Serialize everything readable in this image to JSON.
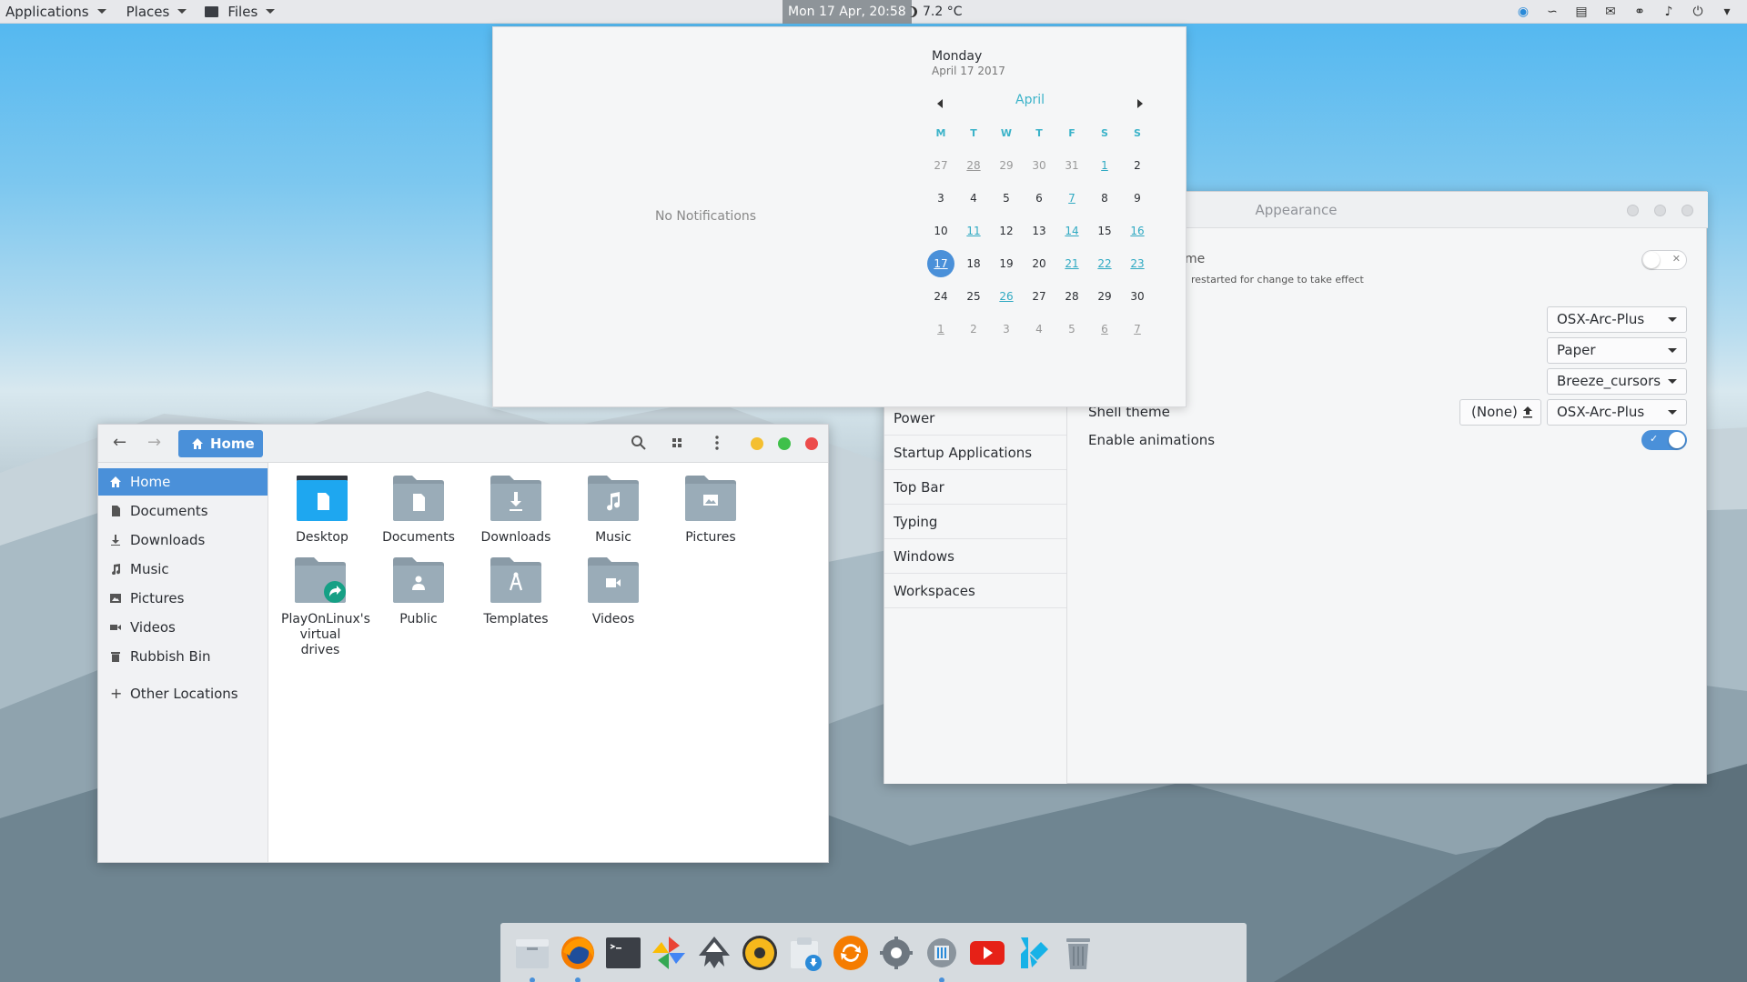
{
  "topbar": {
    "applications": "Applications",
    "places": "Places",
    "files": "Files",
    "clock": "Mon 17 Apr, 20:58",
    "weather": "7.2 °C"
  },
  "notifications": {
    "empty": "No Notifications"
  },
  "calendar": {
    "weekday": "Monday",
    "date": "April 17 2017",
    "month": "April",
    "weekdays": [
      "M",
      "T",
      "W",
      "T",
      "F",
      "S",
      "S"
    ],
    "days": [
      [
        "27",
        "28",
        "29",
        "30",
        "31",
        "1",
        "2"
      ],
      [
        "3",
        "4",
        "5",
        "6",
        "7",
        "8",
        "9"
      ],
      [
        "10",
        "11",
        "12",
        "13",
        "14",
        "15",
        "16"
      ],
      [
        "17",
        "18",
        "19",
        "20",
        "21",
        "22",
        "23"
      ],
      [
        "24",
        "25",
        "26",
        "27",
        "28",
        "29",
        "30"
      ],
      [
        "1",
        "2",
        "3",
        "4",
        "5",
        "6",
        "7"
      ]
    ]
  },
  "appearance": {
    "title": "Appearance",
    "hint_title": "me",
    "hint": "restarted for change to take effect",
    "sidebar": [
      "Power",
      "Startup Applications",
      "Top Bar",
      "Typing",
      "Windows",
      "Workspaces"
    ],
    "gtk_theme": "OSX-Arc-Plus",
    "icon_theme": "Paper",
    "cursor_theme": "Breeze_cursors",
    "shell_theme_label": "Shell theme",
    "shell_none": "(None)",
    "shell_theme": "OSX-Arc-Plus",
    "animations_label": "Enable animations",
    "animations_on": true
  },
  "files": {
    "path": "Home",
    "places": [
      "Home",
      "Documents",
      "Downloads",
      "Music",
      "Pictures",
      "Videos",
      "Rubbish Bin"
    ],
    "other": "Other Locations",
    "items": [
      {
        "name": "Desktop",
        "icon": "desktop-folder-icon"
      },
      {
        "name": "Documents",
        "icon": "documents-folder-icon"
      },
      {
        "name": "Downloads",
        "icon": "downloads-folder-icon"
      },
      {
        "name": "Music",
        "icon": "music-folder-icon"
      },
      {
        "name": "Pictures",
        "icon": "pictures-folder-icon"
      },
      {
        "name": "PlayOnLinux's virtual drives",
        "icon": "link-folder-icon"
      },
      {
        "name": "Public",
        "icon": "public-folder-icon"
      },
      {
        "name": "Templates",
        "icon": "templates-folder-icon"
      },
      {
        "name": "Videos",
        "icon": "videos-folder-icon"
      }
    ]
  },
  "dock": {
    "apps": [
      "files-icon",
      "firefox-icon",
      "terminal-icon",
      "photos-icon",
      "inkscape-icon",
      "rhythmbox-icon",
      "software-install-icon",
      "updates-icon",
      "settings-icon",
      "tweaks-icon",
      "youtube-icon",
      "kodi-icon",
      "trash-icon"
    ]
  },
  "colors": {
    "accent": "#4a90d9",
    "calendar_accent": "#3bb3c9",
    "close": "#ec4b4b",
    "minimize": "#f4bf30",
    "maximize": "#3fc04a"
  }
}
